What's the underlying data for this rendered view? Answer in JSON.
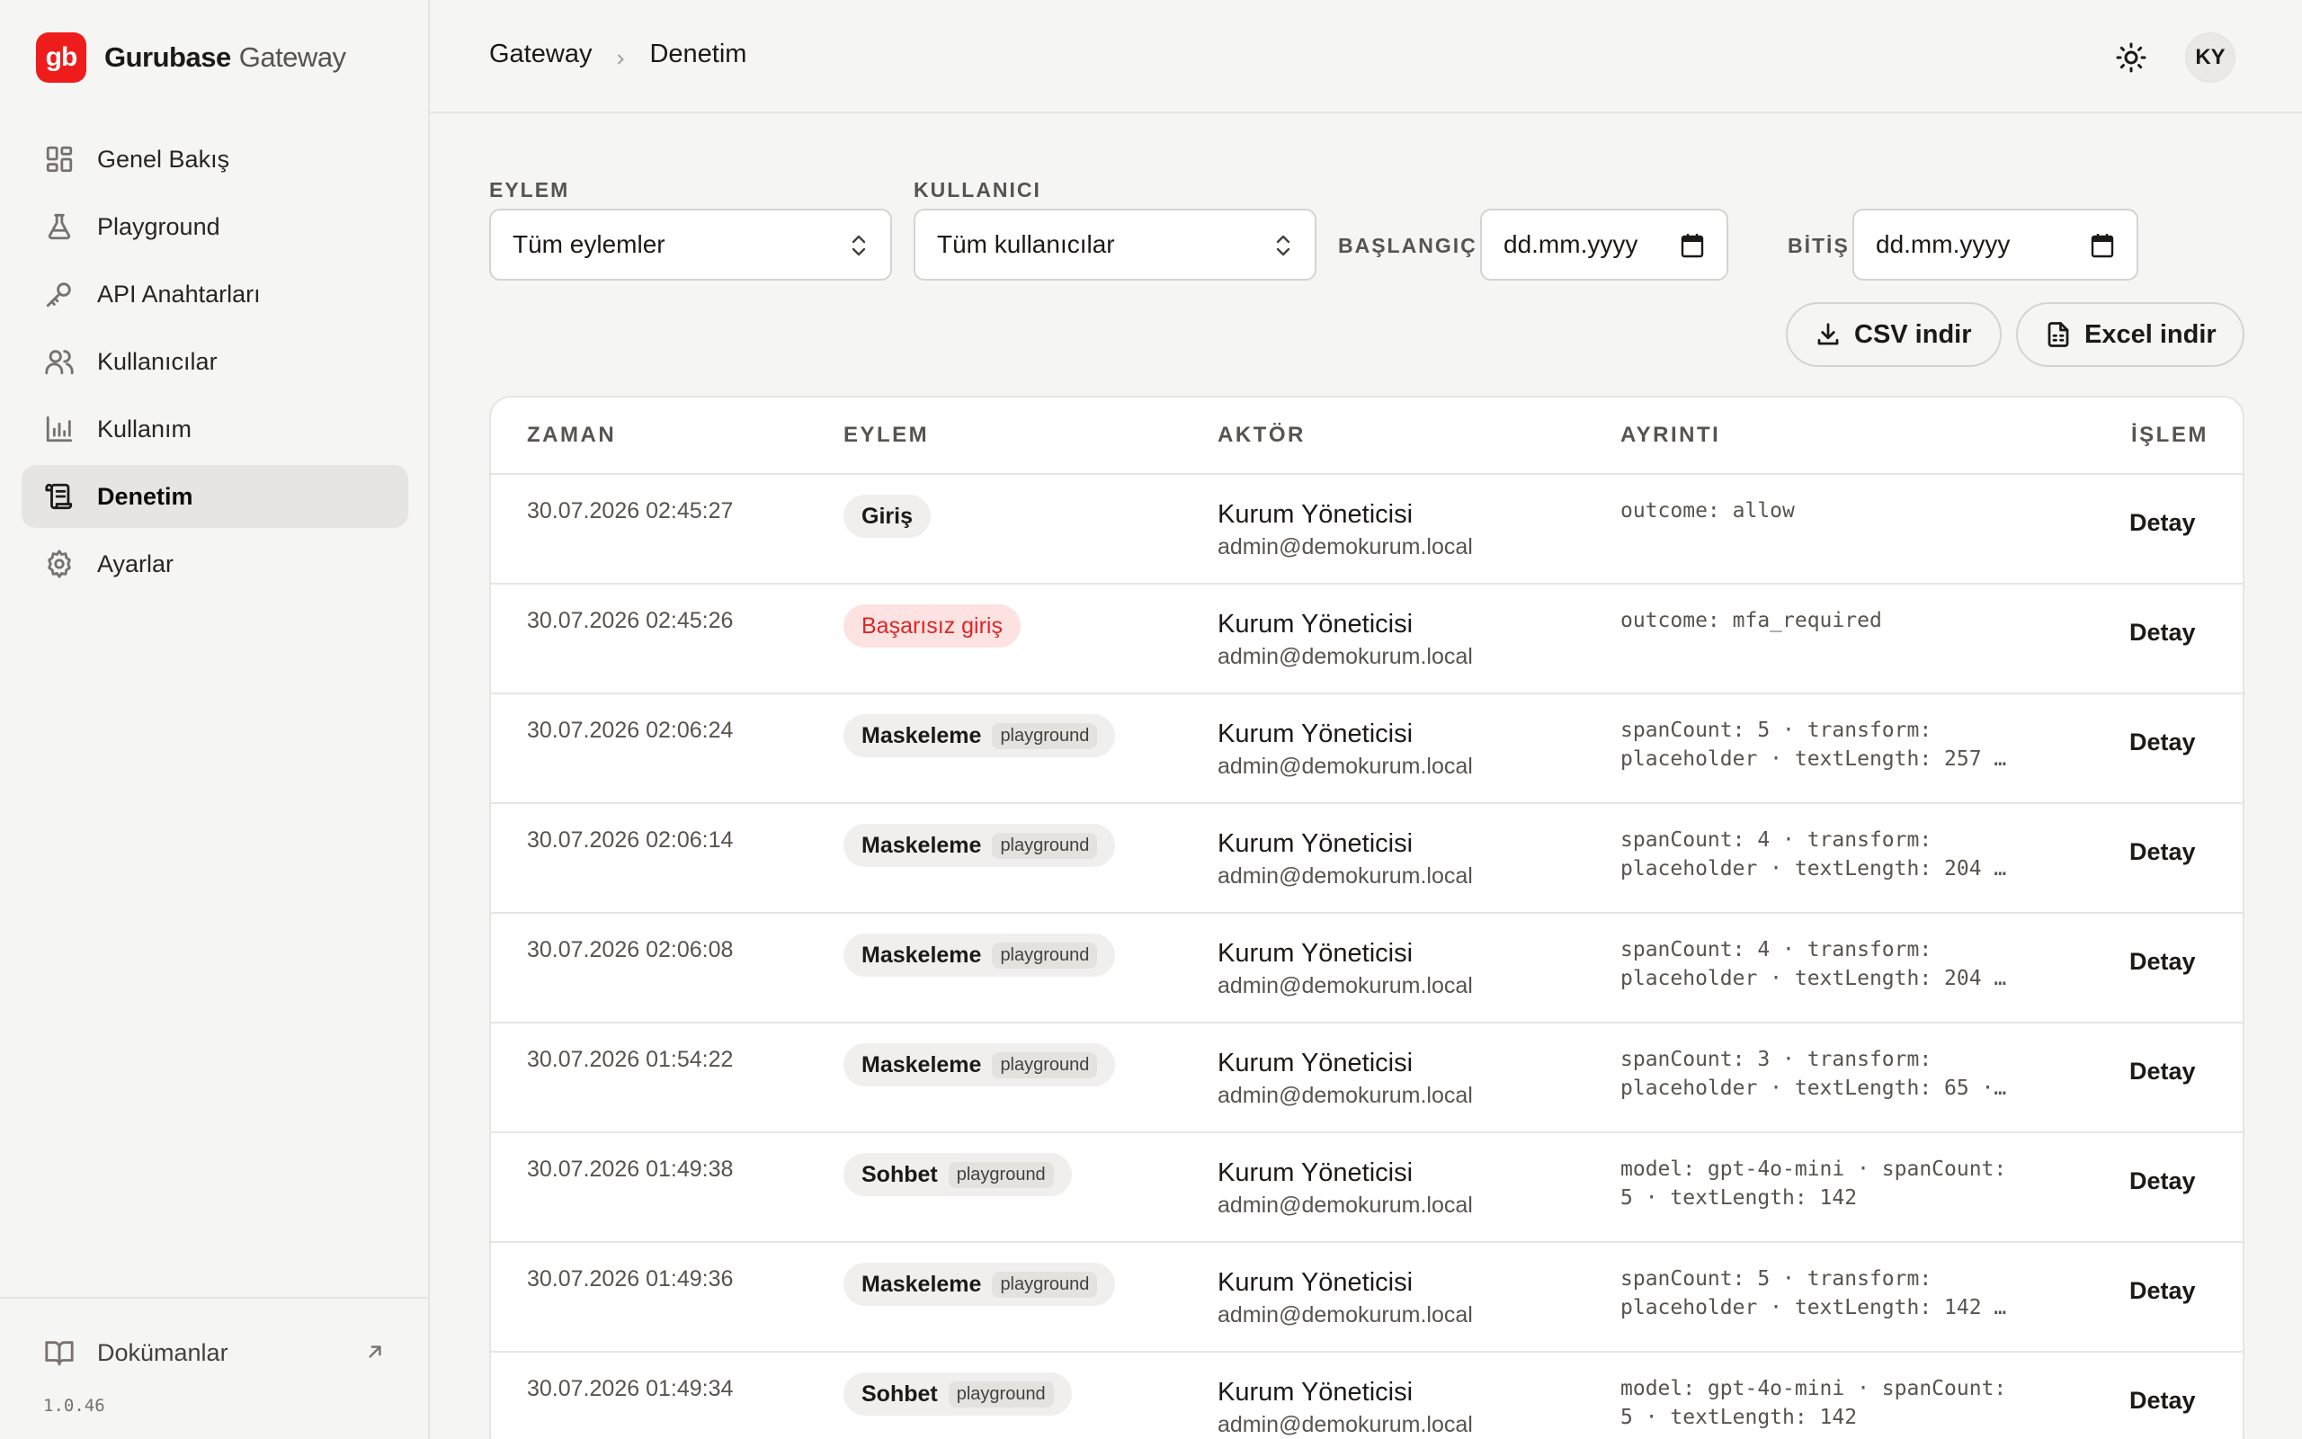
{
  "brand": {
    "logo": "gb",
    "name": "Gurubase",
    "sub": "Gateway"
  },
  "sidebar": {
    "items": [
      {
        "label": "Genel Bakış",
        "icon": "grid-icon"
      },
      {
        "label": "Playground",
        "icon": "flask-icon"
      },
      {
        "label": "API Anahtarları",
        "icon": "key-icon"
      },
      {
        "label": "Kullanıcılar",
        "icon": "users-icon"
      },
      {
        "label": "Kullanım",
        "icon": "bar-chart-icon"
      },
      {
        "label": "Denetim",
        "icon": "scroll-icon",
        "active": true
      },
      {
        "label": "Ayarlar",
        "icon": "gear-icon"
      }
    ],
    "docs_label": "Dokümanlar",
    "version": "1.0.46"
  },
  "header": {
    "breadcrumb": [
      "Gateway",
      "Denetim"
    ],
    "avatar": "KY"
  },
  "filters": {
    "action_label": "EYLEM",
    "action_value": "Tüm eylemler",
    "user_label": "KULLANICI",
    "user_value": "Tüm kullanıcılar",
    "start_label": "BAŞLANGIÇ",
    "start_value": "dd.mm.yyyy",
    "end_label": "BİTİŞ",
    "end_value": "dd.mm.yyyy",
    "csv_label": "CSV indir",
    "excel_label": "Excel indir"
  },
  "table": {
    "columns": [
      "ZAMAN",
      "EYLEM",
      "AKTÖR",
      "AYRINTI",
      "İŞLEM"
    ],
    "rows": [
      {
        "time": "30.07.2026 02:45:27",
        "action": "Giriş",
        "tag": "",
        "type": "normal",
        "actor": "Kurum Yöneticisi",
        "email": "admin@demokurum.local",
        "detail": "outcome: allow",
        "op": "Detay"
      },
      {
        "time": "30.07.2026 02:45:26",
        "action": "Başarısız giriş",
        "tag": "",
        "type": "fail",
        "actor": "Kurum Yöneticisi",
        "email": "admin@demokurum.local",
        "detail": "outcome: mfa_required",
        "op": "Detay"
      },
      {
        "time": "30.07.2026 02:06:24",
        "action": "Maskeleme",
        "tag": "playground",
        "type": "normal",
        "actor": "Kurum Yöneticisi",
        "email": "admin@demokurum.local",
        "detail": "spanCount: 5 · transform:\nplaceholder · textLength: 257 …",
        "op": "Detay"
      },
      {
        "time": "30.07.2026 02:06:14",
        "action": "Maskeleme",
        "tag": "playground",
        "type": "normal",
        "actor": "Kurum Yöneticisi",
        "email": "admin@demokurum.local",
        "detail": "spanCount: 4 · transform:\nplaceholder · textLength: 204 …",
        "op": "Detay"
      },
      {
        "time": "30.07.2026 02:06:08",
        "action": "Maskeleme",
        "tag": "playground",
        "type": "normal",
        "actor": "Kurum Yöneticisi",
        "email": "admin@demokurum.local",
        "detail": "spanCount: 4 · transform:\nplaceholder · textLength: 204 …",
        "op": "Detay"
      },
      {
        "time": "30.07.2026 01:54:22",
        "action": "Maskeleme",
        "tag": "playground",
        "type": "normal",
        "actor": "Kurum Yöneticisi",
        "email": "admin@demokurum.local",
        "detail": "spanCount: 3 · transform:\nplaceholder · textLength: 65 ·…",
        "op": "Detay"
      },
      {
        "time": "30.07.2026 01:49:38",
        "action": "Sohbet",
        "tag": "playground",
        "type": "normal",
        "actor": "Kurum Yöneticisi",
        "email": "admin@demokurum.local",
        "detail": "model: gpt-4o-mini · spanCount:\n5 · textLength: 142",
        "op": "Detay"
      },
      {
        "time": "30.07.2026 01:49:36",
        "action": "Maskeleme",
        "tag": "playground",
        "type": "normal",
        "actor": "Kurum Yöneticisi",
        "email": "admin@demokurum.local",
        "detail": "spanCount: 5 · transform:\nplaceholder · textLength: 142 …",
        "op": "Detay"
      },
      {
        "time": "30.07.2026 01:49:34",
        "action": "Sohbet",
        "tag": "playground",
        "type": "normal",
        "actor": "Kurum Yöneticisi",
        "email": "admin@demokurum.local",
        "detail": "model: gpt-4o-mini · spanCount:\n5 · textLength: 142",
        "op": "Detay"
      }
    ]
  },
  "colors": {
    "brand": "#ef1c1c",
    "fail_text": "#dc2626",
    "fail_bg": "#fde2e2"
  }
}
